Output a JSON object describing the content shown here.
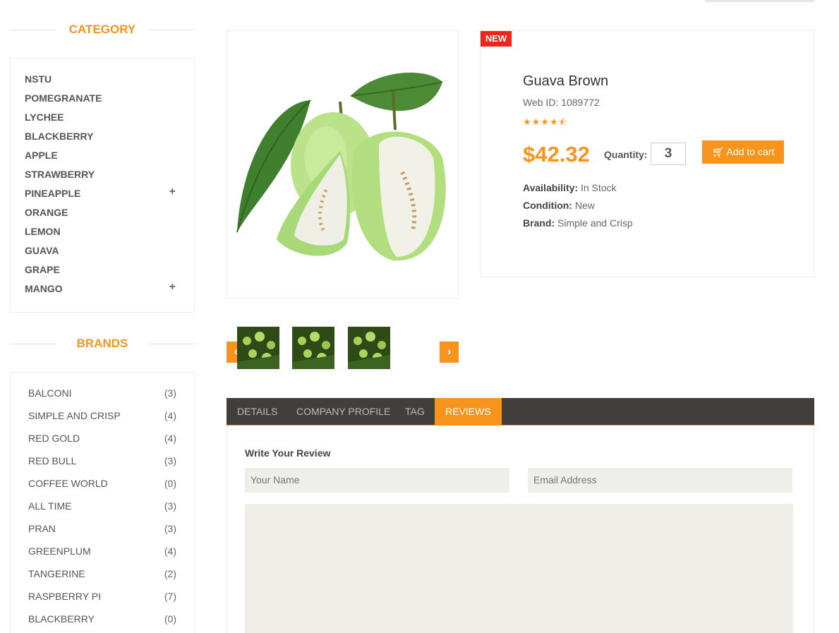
{
  "category": {
    "title": "CATEGORY",
    "items": [
      {
        "label": "NSTU",
        "expand": ""
      },
      {
        "label": "POMEGRANATE",
        "expand": ""
      },
      {
        "label": "LYCHEE",
        "expand": ""
      },
      {
        "label": "BLACKBERRY",
        "expand": ""
      },
      {
        "label": "APPLE",
        "expand": ""
      },
      {
        "label": "STRAWBERRY",
        "expand": ""
      },
      {
        "label": "PINEAPPLE",
        "expand": "+"
      },
      {
        "label": "ORANGE",
        "expand": ""
      },
      {
        "label": "LEMON",
        "expand": ""
      },
      {
        "label": "GUAVA",
        "expand": ""
      },
      {
        "label": "GRAPE",
        "expand": ""
      },
      {
        "label": "MANGO",
        "expand": "+"
      }
    ]
  },
  "brands": {
    "title": "BRANDS",
    "items": [
      {
        "label": "BALCONI",
        "count": "(3)"
      },
      {
        "label": "SIMPLE AND CRISP",
        "count": "(4)"
      },
      {
        "label": "RED GOLD",
        "count": "(4)"
      },
      {
        "label": "RED BULL",
        "count": "(3)"
      },
      {
        "label": "COFFEE WORLD",
        "count": "(0)"
      },
      {
        "label": "ALL TIME",
        "count": "(3)"
      },
      {
        "label": "PRAN",
        "count": "(3)"
      },
      {
        "label": "GREENPLUM",
        "count": "(4)"
      },
      {
        "label": "TANGERINE",
        "count": "(2)"
      },
      {
        "label": "RASPBERRY PI",
        "count": "(7)"
      },
      {
        "label": "BLACKBERRY",
        "count": "(0)"
      }
    ]
  },
  "product": {
    "badge": "NEW",
    "name": "Guava Brown",
    "web_id": "Web ID: 1089772",
    "rating": 4.5,
    "stars": "★★★★⯪",
    "price": "$42.32",
    "quantity_label": "Quantity:",
    "quantity": "3",
    "add_to_cart": " Add to cart",
    "availability_label": "Availability:",
    "availability": " In Stock",
    "condition_label": "Condition:",
    "condition": " New",
    "brand_label": "Brand:",
    "brand": " Simple and Crisp"
  },
  "gallery": {
    "prev": "‹",
    "next": "›"
  },
  "tabs": [
    {
      "label": "DETAILS"
    },
    {
      "label": "COMPANY PROFILE"
    },
    {
      "label": "TAG"
    },
    {
      "label": "REVIEWS"
    }
  ],
  "review": {
    "title": "Write Your Review",
    "name_placeholder": "Your Name",
    "email_placeholder": "Email Address"
  },
  "colors": {
    "accent": "#f7941d",
    "badge": "#f5241a",
    "tabbar": "#403f3c"
  }
}
